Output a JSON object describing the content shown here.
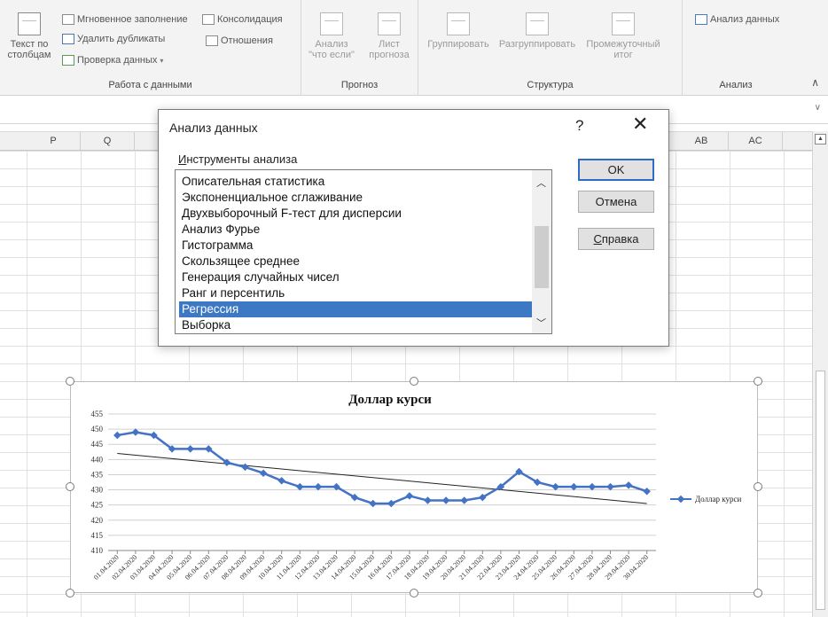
{
  "ribbon": {
    "data_tools": {
      "group_label": "Работа с данными",
      "text_to_columns": "Текст по столбцам",
      "flash_fill": "Мгновенное заполнение",
      "remove_duplicates": "Удалить дубликаты",
      "data_validation": "Проверка данных",
      "consolidate": "Консолидация",
      "relationships": "Отношения"
    },
    "forecast": {
      "group_label": "Прогноз",
      "what_if": "Анализ \"что если\"",
      "forecast_sheet": "Лист прогноза"
    },
    "outline": {
      "group_label": "Структура",
      "group": "Группировать",
      "ungroup": "Разгруппировать",
      "subtotal": "Промежуточный итог"
    },
    "analysis": {
      "group_label": "Анализ",
      "data_analysis": "Анализ данных"
    }
  },
  "columns": [
    "P",
    "Q",
    "AB",
    "AC"
  ],
  "dialog": {
    "title": "Анализ данных",
    "help_glyph": "?",
    "close_glyph": "✕",
    "tools_label": "Инструменты анализа",
    "tools": [
      "Описательная статистика",
      "Экспоненциальное сглаживание",
      "Двухвыборочный F-тест для дисперсии",
      "Анализ Фурье",
      "Гистограмма",
      "Скользящее среднее",
      "Генерация случайных чисел",
      "Ранг и персентиль",
      "Регрессия",
      "Выборка"
    ],
    "selected_tool": "Регрессия",
    "ok": "OK",
    "cancel": "Отмена",
    "help": "Справка"
  },
  "chart_data": {
    "type": "line",
    "title": "Доллар курси",
    "categories": [
      "01.04.2020",
      "02.04.2020",
      "03.04.2020",
      "04.04.2020",
      "05.04.2020",
      "06.04.2020",
      "07.04.2020",
      "08.04.2020",
      "09.04.2020",
      "10.04.2020",
      "11.04.2020",
      "12.04.2020",
      "13.04.2020",
      "14.04.2020",
      "15.04.2020",
      "16.04.2020",
      "17.04.2020",
      "18.04.2020",
      "19.04.2020",
      "20.04.2020",
      "21.04.2020",
      "22.04.2020",
      "23.04.2020",
      "24.04.2020",
      "25.04.2020",
      "26.04.2020",
      "27.04.2020",
      "28.04.2020",
      "29.04.2020",
      "30.04.2020"
    ],
    "series": [
      {
        "name": "Доллар курси",
        "color": "#4472c4",
        "values": [
          448,
          449,
          448,
          443.5,
          443.5,
          443.5,
          439,
          437.5,
          435.5,
          433,
          431,
          431,
          431,
          427.5,
          425.5,
          425.5,
          428,
          426.5,
          426.5,
          426.5,
          427.5,
          431,
          436,
          432.5,
          431,
          431,
          431,
          431,
          431.5,
          429.5
        ]
      }
    ],
    "trendline": {
      "type": "linear",
      "start": 442,
      "end": 425.5,
      "color": "#222222"
    },
    "yticks": [
      410,
      415,
      420,
      425,
      430,
      435,
      440,
      445,
      450,
      455
    ],
    "ylim": [
      410,
      455
    ],
    "legend_position": "right",
    "grid": true
  }
}
